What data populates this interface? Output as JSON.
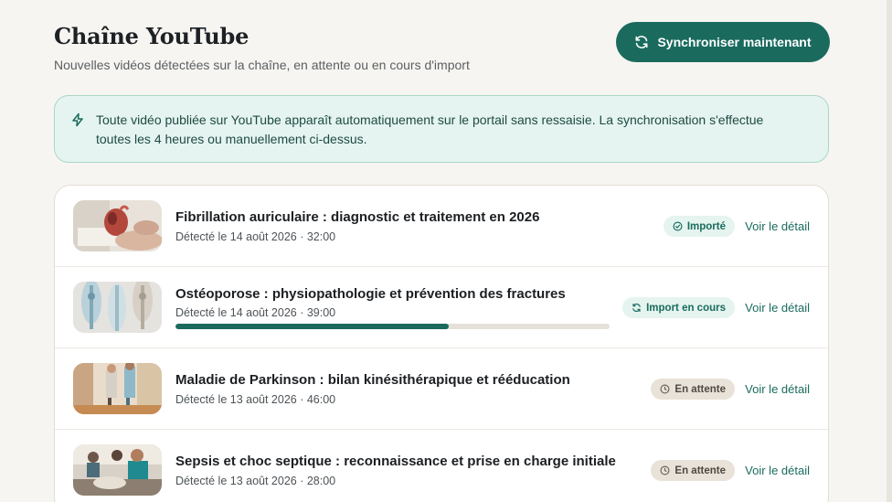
{
  "header": {
    "title": "Chaîne YouTube",
    "subtitle": "Nouvelles vidéos détectées sur la chaîne, en attente ou en cours d'import",
    "sync_button_label": "Synchroniser maintenant",
    "sync_icon": "refresh-icon"
  },
  "banner": {
    "icon": "bolt-icon",
    "text_line1": "Toute vidéo publiée sur YouTube apparaît automatiquement sur le portail sans ressaisie. La synchronisation s'effectue",
    "text_line2": "toutes les 4 heures ou manuellement ci-dessus."
  },
  "colors": {
    "accent": "#1a6b5e",
    "background": "#f7f5f1",
    "banner_bg": "#e5f4f0",
    "waiting_badge_bg": "#e8e2d8"
  },
  "videos": [
    {
      "title": "Fibrillation auriculaire : diagnostic et traitement en 2026",
      "meta": "Détecté le 14 août 2026 · 32:00",
      "status": "Importé",
      "status_icon": "check-circle-icon",
      "detail_label": "Voir le détail"
    },
    {
      "title": "Ostéoporose : physiopathologie et prévention des fractures",
      "meta": "Détecté le 14 août 2026 · 39:00",
      "status": "Import en cours",
      "status_icon": "refresh-icon",
      "progress": 0.63,
      "detail_label": "Voir le détail"
    },
    {
      "title": "Maladie de Parkinson : bilan kinésithérapique et rééducation",
      "meta": "Détecté le 13 août 2026 · 46:00",
      "status": "En attente",
      "status_icon": "clock-icon",
      "detail_label": "Voir le détail"
    },
    {
      "title": "Sepsis et choc septique : reconnaissance et prise en charge initiale",
      "meta": "Détecté le 13 août 2026 · 28:00",
      "status": "En attente",
      "status_icon": "clock-icon",
      "detail_label": "Voir le détail"
    }
  ]
}
